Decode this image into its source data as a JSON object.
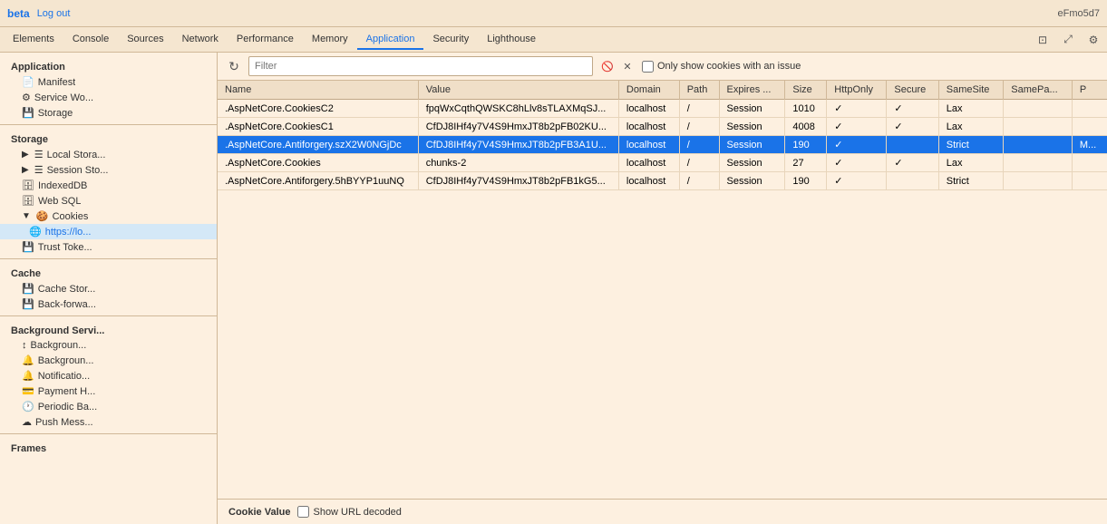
{
  "browser": {
    "logo": "beta",
    "logout_label": "Log out",
    "session_id": "eFmo5d7"
  },
  "tabs": [
    {
      "label": "Elements",
      "active": false
    },
    {
      "label": "Console",
      "active": false
    },
    {
      "label": "Sources",
      "active": false
    },
    {
      "label": "Network",
      "active": false
    },
    {
      "label": "Performance",
      "active": false
    },
    {
      "label": "Memory",
      "active": false
    },
    {
      "label": "Application",
      "active": true
    },
    {
      "label": "Security",
      "active": false
    },
    {
      "label": "Lighthouse",
      "active": false
    }
  ],
  "top_icons": [
    {
      "name": "dock-icon",
      "symbol": "⊡"
    },
    {
      "name": "expand-icon",
      "symbol": "⤢"
    },
    {
      "name": "settings-icon",
      "symbol": "⚙"
    }
  ],
  "sidebar": {
    "application_label": "Application",
    "items_app": [
      {
        "label": "Manifest",
        "icon": "📄",
        "indent": 1
      },
      {
        "label": "Service Wo...",
        "icon": "⚙",
        "indent": 1
      },
      {
        "label": "Storage",
        "icon": "💾",
        "indent": 1
      }
    ],
    "storage_label": "Storage",
    "items_storage": [
      {
        "label": "Local Stora...",
        "icon": "☰☰",
        "indent": 1,
        "has_tri": true
      },
      {
        "label": "Session Sto...",
        "icon": "☰☰",
        "indent": 1,
        "has_tri": true
      },
      {
        "label": "IndexedDB",
        "icon": "🗄",
        "indent": 1
      },
      {
        "label": "Web SQL",
        "icon": "🗄",
        "indent": 1
      },
      {
        "label": "Cookies",
        "icon": "🍪",
        "indent": 1,
        "has_tri": true,
        "expanded": true
      },
      {
        "label": "https://lo...",
        "icon": "🌐",
        "indent": 2,
        "active": true
      },
      {
        "label": "Trust Toke...",
        "icon": "💾",
        "indent": 1
      }
    ],
    "cache_label": "Cache",
    "items_cache": [
      {
        "label": "Cache Stor...",
        "icon": "💾",
        "indent": 1
      },
      {
        "label": "Back-forwa...",
        "icon": "💾",
        "indent": 1
      }
    ],
    "bg_label": "Background Servi...",
    "items_bg": [
      {
        "label": "Backgroun...",
        "icon": "↕",
        "indent": 1
      },
      {
        "label": "Backgroun...",
        "icon": "🔔",
        "indent": 1
      },
      {
        "label": "Notificatio...",
        "icon": "🔔",
        "indent": 1
      },
      {
        "label": "Payment H...",
        "icon": "💳",
        "indent": 1
      },
      {
        "label": "Periodic Ba...",
        "icon": "🕐",
        "indent": 1
      },
      {
        "label": "Push Mess...",
        "icon": "☁",
        "indent": 1
      }
    ],
    "frames_label": "Frames"
  },
  "filter": {
    "placeholder": "Filter",
    "refresh_icon": "↻",
    "delete_icon": "🚫",
    "clear_icon": "✕",
    "checkbox_label": "Only show cookies with an issue"
  },
  "table": {
    "columns": [
      "Name",
      "Value",
      "Domain",
      "Path",
      "Expires ...",
      "Size",
      "HttpOnly",
      "Secure",
      "SameSite",
      "SamePa...",
      "P"
    ],
    "rows": [
      {
        "name": ".AspNetCore.CookiesC2",
        "value": "fpqWxCqthQWSKC8hLlv8sTLAXMqSJ...",
        "domain": "localhost",
        "path": "/",
        "expires": "Session",
        "size": "1010",
        "httponly": "✓",
        "secure": "✓",
        "samesite": "Lax",
        "samepage": "",
        "p": "",
        "selected": false
      },
      {
        "name": ".AspNetCore.CookiesC1",
        "value": "CfDJ8IHf4y7V4S9HmxJT8b2pFB02KU...",
        "domain": "localhost",
        "path": "/",
        "expires": "Session",
        "size": "4008",
        "httponly": "✓",
        "secure": "✓",
        "samesite": "Lax",
        "samepage": "",
        "p": "",
        "selected": false
      },
      {
        "name": ".AspNetCore.Antiforgery.szX2W0NGjDc",
        "value": "CfDJ8IHf4y7V4S9HmxJT8b2pFB3A1U...",
        "domain": "localhost",
        "path": "/",
        "expires": "Session",
        "size": "190",
        "httponly": "✓",
        "secure": "",
        "samesite": "Strict",
        "samepage": "",
        "p": "M...",
        "selected": true
      },
      {
        "name": ".AspNetCore.Cookies",
        "value": "chunks-2",
        "domain": "localhost",
        "path": "/",
        "expires": "Session",
        "size": "27",
        "httponly": "✓",
        "secure": "✓",
        "samesite": "Lax",
        "samepage": "",
        "p": "",
        "selected": false
      },
      {
        "name": ".AspNetCore.Antiforgery.5hBYYP1uuNQ",
        "value": "CfDJ8IHf4y7V4S9HmxJT8b2pFB1kG5...",
        "domain": "localhost",
        "path": "/",
        "expires": "Session",
        "size": "190",
        "httponly": "✓",
        "secure": "",
        "samesite": "Strict",
        "samepage": "",
        "p": "",
        "selected": false
      }
    ]
  },
  "bottom": {
    "cookie_value_label": "Cookie Value",
    "show_url_label": "Show URL decoded"
  },
  "colors": {
    "selected_row_bg": "#1a73e8",
    "sidebar_active_bg": "#d4e8f7",
    "header_bg": "#f0dfc8",
    "body_bg": "#fdf0e0"
  }
}
